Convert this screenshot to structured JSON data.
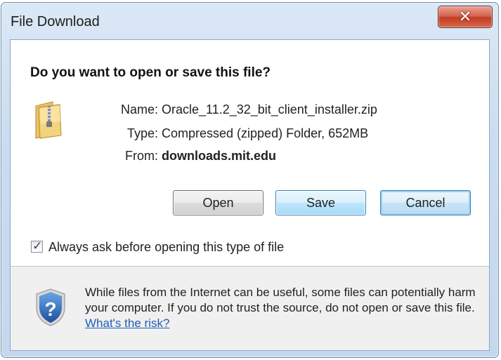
{
  "window": {
    "title": "File Download",
    "close_label": "✕"
  },
  "dialog": {
    "question": "Do you want to open or save this file?",
    "fields": [
      {
        "label": "Name:",
        "value": "Oracle_11.2_32_bit_client_installer.zip"
      },
      {
        "label": "Type:",
        "value": "Compressed (zipped) Folder, 652MB"
      },
      {
        "label": "From:",
        "value": "downloads.mit.edu"
      }
    ],
    "buttons": {
      "open": "Open",
      "save": "Save",
      "cancel": "Cancel"
    },
    "checkbox": {
      "label": "Always ask before opening this type of file",
      "checked": true
    },
    "warning": {
      "text": "While files from the Internet can be useful, some files can potentially harm your computer. If you do not trust the source, do not open or save this file.",
      "link": "What's the risk?"
    }
  },
  "icons": {
    "file": "zip-folder-icon",
    "security": "shield-question-icon"
  },
  "colors": {
    "titlebar": "#c9dcf0",
    "close_button": "#c23d24",
    "link": "#1f5fb7",
    "footer": "#f0f0f0"
  }
}
